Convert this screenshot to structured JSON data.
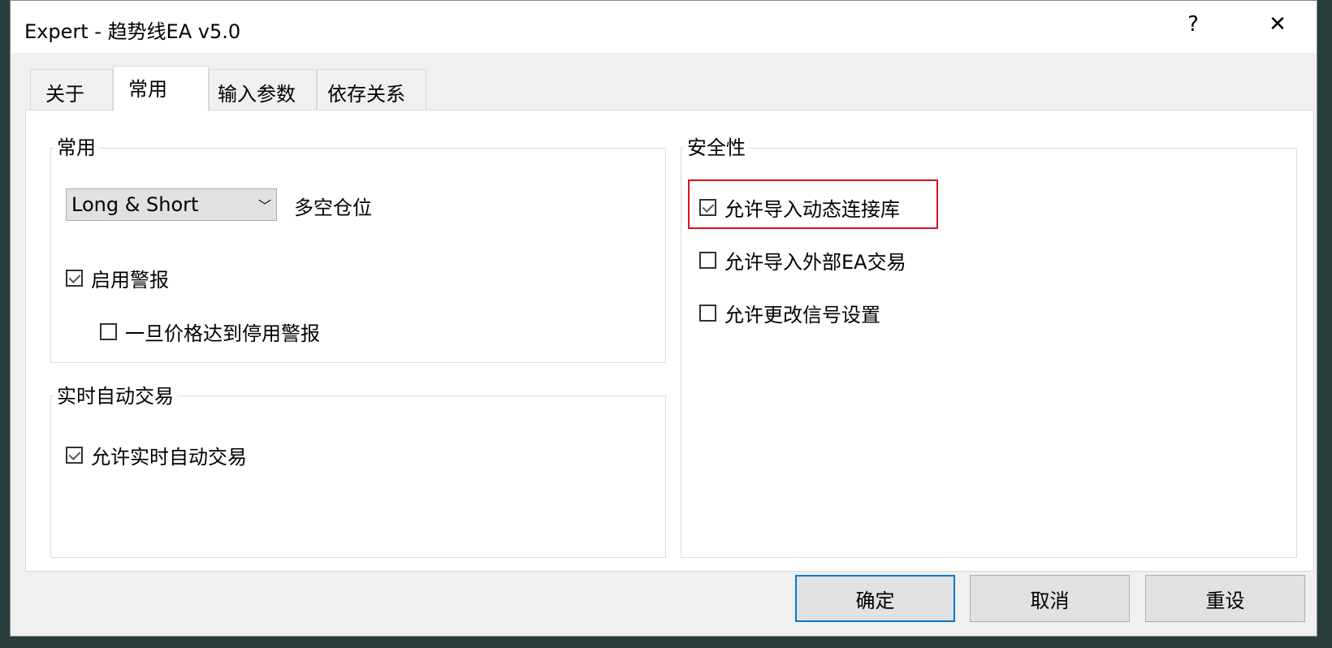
{
  "window": {
    "title": "Expert - 趋势线EA v5.0",
    "help": "?",
    "close": "✕"
  },
  "tabs": [
    {
      "label": "关于"
    },
    {
      "label": "常用",
      "active": true
    },
    {
      "label": "输入参数"
    },
    {
      "label": "依存关系"
    }
  ],
  "common": {
    "title": "常用",
    "position_mode": {
      "value": "Long & Short",
      "label": "多空仓位"
    },
    "enable_alerts": {
      "label": "启用警报",
      "checked": true
    },
    "disable_alert_on_price": {
      "label": "一旦价格达到停用警报",
      "checked": false
    }
  },
  "live": {
    "title": "实时自动交易",
    "allow_live": {
      "label": "允许实时自动交易",
      "checked": true
    }
  },
  "security": {
    "title": "安全性",
    "items": [
      {
        "label": "允许导入动态连接库",
        "checked": true,
        "highlighted": true
      },
      {
        "label": "允许导入外部EA交易",
        "checked": false
      },
      {
        "label": "允许更改信号设置",
        "checked": false
      }
    ]
  },
  "buttons": {
    "ok": "确定",
    "cancel": "取消",
    "reset": "重设"
  },
  "colors": {
    "highlight": "#d9131b",
    "focus": "#0078d7"
  }
}
